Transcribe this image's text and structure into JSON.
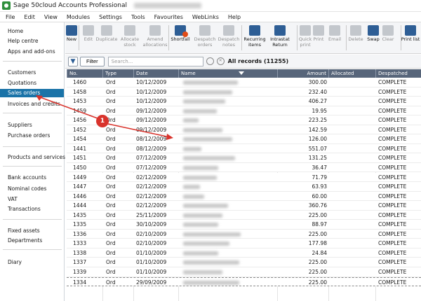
{
  "titlebar": {
    "app_title": "Sage 50cloud Accounts Professional"
  },
  "menu": [
    "File",
    "Edit",
    "View",
    "Modules",
    "Settings",
    "Tools",
    "Favourites",
    "WebLinks",
    "Help"
  ],
  "sidebar": {
    "items": [
      {
        "label": "Home"
      },
      {
        "label": "Help centre"
      },
      {
        "label": "Apps and add-ons"
      },
      {
        "label": "Customers"
      },
      {
        "label": "Quotations"
      },
      {
        "label": "Sales orders",
        "active": true
      },
      {
        "label": "Invoices and credits"
      },
      {
        "label": "Suppliers"
      },
      {
        "label": "Purchase orders"
      },
      {
        "label": "Products and services"
      },
      {
        "label": "Bank accounts"
      },
      {
        "label": "Nominal codes"
      },
      {
        "label": "VAT"
      },
      {
        "label": "Transactions"
      },
      {
        "label": "Fixed assets"
      },
      {
        "label": "Departments"
      },
      {
        "label": "Diary"
      }
    ]
  },
  "toolbar": {
    "buttons": [
      {
        "label": "New",
        "enabled": true,
        "icon": "new-document-icon"
      },
      {
        "label": "Edit",
        "enabled": false,
        "icon": "edit-icon"
      },
      {
        "label": "Duplicate",
        "enabled": false,
        "icon": "duplicate-icon"
      },
      {
        "label": "Allocate\nstock",
        "enabled": false,
        "icon": "allocate-stock-icon"
      },
      {
        "label": "Amend\nallocations",
        "enabled": false,
        "icon": "amend-allocations-icon"
      },
      {
        "label": "Shortfall",
        "enabled": true,
        "icon": "shortfall-icon"
      },
      {
        "label": "Despatch\norders",
        "enabled": false,
        "icon": "despatch-orders-icon"
      },
      {
        "label": "Despatch\nnotes",
        "enabled": false,
        "icon": "despatch-notes-icon"
      },
      {
        "label": "Recurring\nitems",
        "enabled": true,
        "icon": "recurring-items-icon"
      },
      {
        "label": "Intrastat\nReturn",
        "enabled": true,
        "icon": "intrastat-return-icon"
      },
      {
        "label": "Quick\nprint",
        "enabled": false,
        "icon": "quick-print-icon"
      },
      {
        "label": "Print",
        "enabled": false,
        "icon": "print-icon"
      },
      {
        "label": "Email",
        "enabled": false,
        "icon": "email-icon"
      },
      {
        "label": "Delete",
        "enabled": false,
        "icon": "delete-icon"
      },
      {
        "label": "Swap",
        "enabled": true,
        "icon": "swap-icon"
      },
      {
        "label": "Clear",
        "enabled": false,
        "icon": "clear-icon"
      },
      {
        "label": "Print list",
        "enabled": true,
        "icon": "print-list-icon"
      }
    ]
  },
  "filter": {
    "button_label": "Filter",
    "search_placeholder": "Search...",
    "records_label": "All records (11255)"
  },
  "grid": {
    "columns": [
      "No.",
      "Type",
      "Date",
      "Name",
      "Amount",
      "Allocated",
      "Despatched"
    ],
    "rows": [
      {
        "no": "1460",
        "type": "Ord",
        "date": "10/12/2009",
        "amount": "300.00",
        "despatched": "COMPLETE"
      },
      {
        "no": "1458",
        "type": "Ord",
        "date": "10/12/2009",
        "amount": "232.40",
        "despatched": "COMPLETE"
      },
      {
        "no": "1453",
        "type": "Ord",
        "date": "10/12/2009",
        "amount": "406.27",
        "despatched": "COMPLETE"
      },
      {
        "no": "1459",
        "type": "Ord",
        "date": "09/12/2009",
        "amount": "19.95",
        "despatched": "COMPLETE"
      },
      {
        "no": "1456",
        "type": "Ord",
        "date": "09/12/2009",
        "amount": "223.25",
        "despatched": "COMPLETE"
      },
      {
        "no": "1452",
        "type": "Ord",
        "date": "09/12/2009",
        "amount": "142.59",
        "despatched": "COMPLETE"
      },
      {
        "no": "1454",
        "type": "Ord",
        "date": "08/12/2009",
        "amount": "126.00",
        "despatched": "COMPLETE"
      },
      {
        "no": "1441",
        "type": "Ord",
        "date": "08/12/2009",
        "amount": "551.07",
        "despatched": "COMPLETE"
      },
      {
        "no": "1451",
        "type": "Ord",
        "date": "07/12/2009",
        "amount": "131.25",
        "despatched": "COMPLETE"
      },
      {
        "no": "1450",
        "type": "Ord",
        "date": "07/12/2009",
        "amount": "36.47",
        "despatched": "COMPLETE"
      },
      {
        "no": "1449",
        "type": "Ord",
        "date": "02/12/2009",
        "amount": "71.79",
        "despatched": "COMPLETE"
      },
      {
        "no": "1447",
        "type": "Ord",
        "date": "02/12/2009",
        "amount": "63.93",
        "despatched": "COMPLETE"
      },
      {
        "no": "1446",
        "type": "Ord",
        "date": "02/12/2009",
        "amount": "60.00",
        "despatched": "COMPLETE"
      },
      {
        "no": "1444",
        "type": "Ord",
        "date": "02/12/2009",
        "amount": "360.76",
        "despatched": "COMPLETE"
      },
      {
        "no": "1435",
        "type": "Ord",
        "date": "25/11/2009",
        "amount": "225.00",
        "despatched": "COMPLETE"
      },
      {
        "no": "1335",
        "type": "Ord",
        "date": "30/10/2009",
        "amount": "88.97",
        "despatched": "COMPLETE"
      },
      {
        "no": "1336",
        "type": "Ord",
        "date": "02/10/2009",
        "amount": "225.00",
        "despatched": "COMPLETE"
      },
      {
        "no": "1333",
        "type": "Ord",
        "date": "02/10/2009",
        "amount": "177.98",
        "despatched": "COMPLETE"
      },
      {
        "no": "1338",
        "type": "Ord",
        "date": "01/10/2009",
        "amount": "24.84",
        "despatched": "COMPLETE"
      },
      {
        "no": "1337",
        "type": "Ord",
        "date": "01/10/2009",
        "amount": "225.00",
        "despatched": "COMPLETE"
      },
      {
        "no": "1339",
        "type": "Ord",
        "date": "01/10/2009",
        "amount": "225.00",
        "despatched": "COMPLETE"
      },
      {
        "no": "1334",
        "type": "Ord",
        "date": "29/09/2009",
        "amount": "225.00",
        "despatched": "COMPLETE"
      }
    ]
  },
  "annotation": {
    "badge_label": "1",
    "color": "#d9332c"
  },
  "colors": {
    "accent": "#1a73a8",
    "grid_header": "#57657a",
    "toolbar_bg": "#f4f5f7"
  }
}
